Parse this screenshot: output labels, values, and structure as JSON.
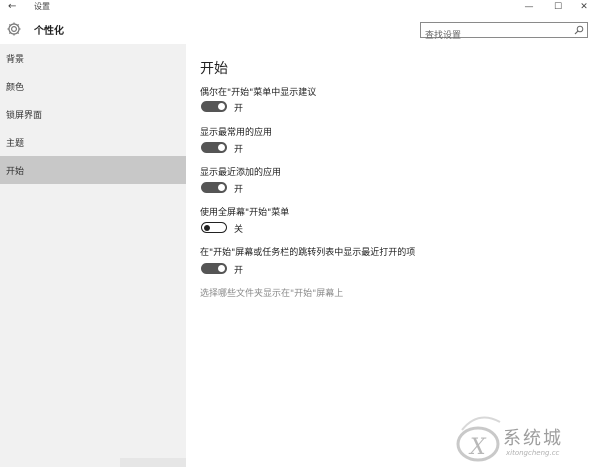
{
  "window": {
    "back_glyph": "←",
    "title": "设置",
    "min_glyph": "—",
    "max_glyph": "☐",
    "close_glyph": "✕"
  },
  "header": {
    "section_title": "个性化",
    "search_placeholder": "查找设置",
    "gear_icon": "gear-icon",
    "search_icon": "search-icon"
  },
  "sidebar": {
    "items": [
      {
        "label": "背景"
      },
      {
        "label": "颜色"
      },
      {
        "label": "锁屏界面"
      },
      {
        "label": "主题"
      },
      {
        "label": "开始",
        "selected": true
      }
    ]
  },
  "main": {
    "page_title": "开始",
    "settings": [
      {
        "label": "偶尔在\"开始\"菜单中显示建议",
        "state": "开",
        "on": true
      },
      {
        "label": "显示最常用的应用",
        "state": "开",
        "on": true
      },
      {
        "label": "显示最近添加的应用",
        "state": "开",
        "on": true
      },
      {
        "label": "使用全屏幕\"开始\"菜单",
        "state": "关",
        "on": false
      },
      {
        "label": "在\"开始\"屏幕或任务栏的跳转列表中显示最近打开的项",
        "state": "开",
        "on": true
      }
    ],
    "link": "选择哪些文件夹显示在\"开始\"屏幕上"
  },
  "watermark": {
    "text": "系统城",
    "url": "xitongcheng.cc"
  },
  "colors": {
    "sidebar_bg": "#f1f1f1",
    "selected_bg": "#c8c8c8",
    "toggle_on": "#555555",
    "link": "#8a8a8a"
  }
}
